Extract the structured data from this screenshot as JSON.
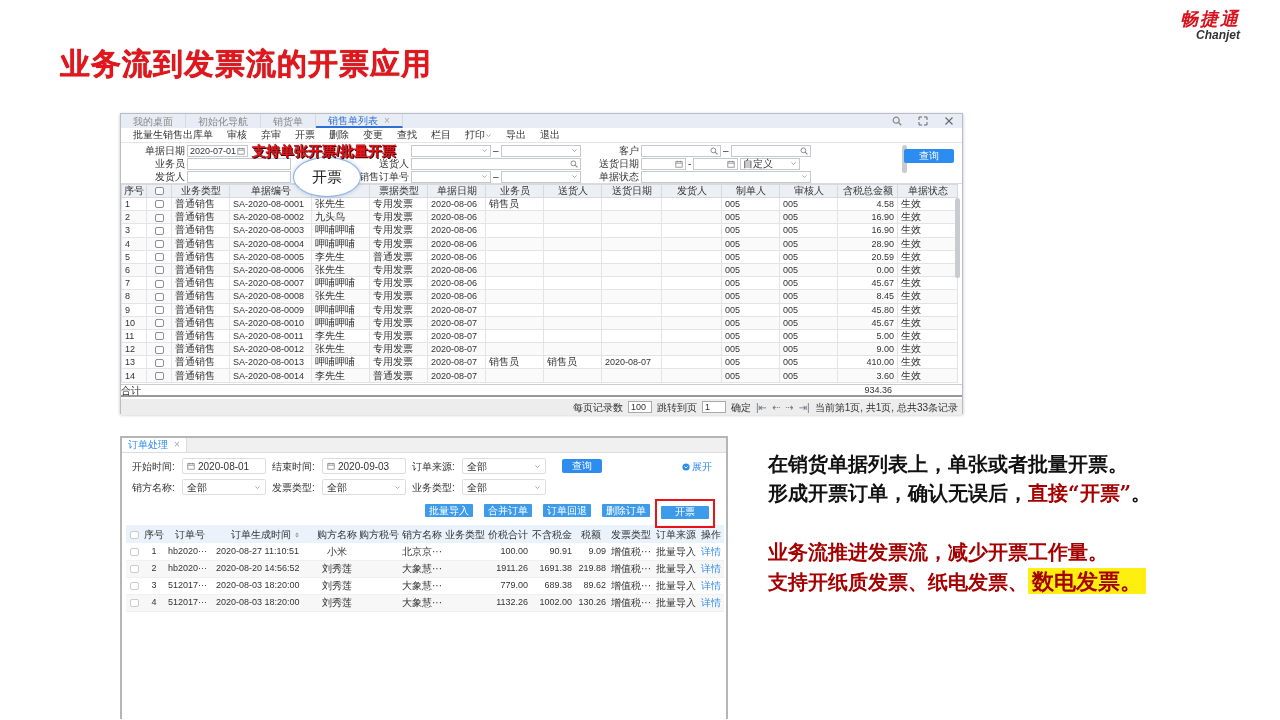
{
  "slide": {
    "title": "业务流到发票流的开票应用",
    "logo": {
      "name": "畅捷通",
      "latin": "Chanjet"
    }
  },
  "top_window": {
    "tabs": [
      {
        "label": "我的桌面",
        "selected": false,
        "closable": false
      },
      {
        "label": "初始化导航",
        "selected": false,
        "closable": false
      },
      {
        "label": "销货单",
        "selected": false,
        "closable": false
      },
      {
        "label": "销售单列表",
        "selected": true,
        "closable": true
      }
    ],
    "close_glyph": "×",
    "toolbar": [
      {
        "label": "批量生销售出库单",
        "dropdown": false
      },
      {
        "label": "审核",
        "dropdown": false
      },
      {
        "label": "弃审",
        "dropdown": false
      },
      {
        "label": "开票",
        "dropdown": false
      },
      {
        "label": "删除",
        "dropdown": false
      },
      {
        "label": "变更",
        "dropdown": false
      },
      {
        "label": "查找",
        "dropdown": false
      },
      {
        "label": "栏目",
        "dropdown": false
      },
      {
        "label": "打印",
        "dropdown": true
      },
      {
        "label": "导出",
        "dropdown": false
      },
      {
        "label": "退出",
        "dropdown": false
      }
    ],
    "filter_rows": [
      [
        {
          "label": "单据日期",
          "fields": [
            {
              "kind": "date",
              "value": "2020-07-01"
            }
          ]
        },
        {
          "fields": [
            {
              "kind": "select"
            },
            {
              "kind": "sep",
              "text": "–"
            },
            {
              "kind": "select"
            }
          ]
        },
        {
          "label": "客户",
          "fields": [
            {
              "kind": "search"
            },
            {
              "kind": "sep",
              "text": "–"
            },
            {
              "kind": "search"
            }
          ]
        }
      ],
      [
        {
          "label": "业务员",
          "fields": [
            {
              "kind": "text"
            }
          ]
        },
        {
          "label": "送货人",
          "fields": [
            {
              "kind": "search"
            }
          ]
        },
        {
          "label": "送货日期",
          "fields": [
            {
              "kind": "date"
            },
            {
              "kind": "sep",
              "text": "-"
            },
            {
              "kind": "date"
            },
            {
              "kind": "select",
              "value": "自定义"
            }
          ]
        }
      ],
      [
        {
          "label": "发货人",
          "fields": [
            {
              "kind": "text"
            }
          ]
        },
        {
          "label": "销售订单号",
          "fields": [
            {
              "kind": "select"
            },
            {
              "kind": "sep",
              "text": "–"
            },
            {
              "kind": "select"
            }
          ]
        },
        {
          "label": "单据状态",
          "fields": [
            {
              "kind": "select"
            }
          ]
        }
      ]
    ],
    "query_button": "查询",
    "callout": {
      "text": "支持单张开票/批量开票",
      "bubble": "开票"
    },
    "table": {
      "all_checked": false,
      "columns": [
        {
          "label": "序号",
          "kind": "text"
        },
        {
          "kind": "checkbox"
        },
        {
          "label": "业务类型",
          "kind": "text"
        },
        {
          "label": "单据编号",
          "kind": "text"
        },
        {
          "kind": "text"
        },
        {
          "label": "票据类型",
          "kind": "text"
        },
        {
          "label": "单据日期",
          "kind": "text"
        },
        {
          "label": "业务员",
          "kind": "text"
        },
        {
          "label": "送货人",
          "kind": "text"
        },
        {
          "label": "送货日期",
          "kind": "text"
        },
        {
          "label": "发货人",
          "kind": "text"
        },
        {
          "label": "制单人",
          "kind": "text"
        },
        {
          "label": "审核人",
          "kind": "text"
        },
        {
          "label": "含税总金额",
          "kind": "amount"
        },
        {
          "label": "单据状态",
          "kind": "text"
        }
      ],
      "rows": [
        {
          "checked": false,
          "cells": [
            "1",
            null,
            "普通销售",
            "SA-2020-08-0001",
            "张先生",
            "专用发票",
            "2020-08-06",
            "销售员",
            null,
            null,
            null,
            "005",
            "005",
            "4.58",
            "生效"
          ]
        },
        {
          "checked": false,
          "cells": [
            "2",
            null,
            "普通销售",
            "SA-2020-08-0002",
            "九头鸟",
            "专用发票",
            "2020-08-06",
            null,
            null,
            null,
            null,
            "005",
            "005",
            "16.90",
            "生效"
          ]
        },
        {
          "checked": false,
          "cells": [
            "3",
            null,
            "普通销售",
            "SA-2020-08-0003",
            "呷哺呷哺",
            "专用发票",
            "2020-08-06",
            null,
            null,
            null,
            null,
            "005",
            "005",
            "16.90",
            "生效"
          ]
        },
        {
          "checked": false,
          "cells": [
            "4",
            null,
            "普通销售",
            "SA-2020-08-0004",
            "呷哺呷哺",
            "专用发票",
            "2020-08-06",
            null,
            null,
            null,
            null,
            "005",
            "005",
            "28.90",
            "生效"
          ]
        },
        {
          "checked": false,
          "cells": [
            "5",
            null,
            "普通销售",
            "SA-2020-08-0005",
            "李先生",
            "普通发票",
            "2020-08-06",
            null,
            null,
            null,
            null,
            "005",
            "005",
            "20.59",
            "生效"
          ]
        },
        {
          "checked": false,
          "cells": [
            "6",
            null,
            "普通销售",
            "SA-2020-08-0006",
            "张先生",
            "专用发票",
            "2020-08-06",
            null,
            null,
            null,
            null,
            "005",
            "005",
            "0.00",
            "生效"
          ]
        },
        {
          "checked": false,
          "cells": [
            "7",
            null,
            "普通销售",
            "SA-2020-08-0007",
            "呷哺呷哺",
            "专用发票",
            "2020-08-06",
            null,
            null,
            null,
            null,
            "005",
            "005",
            "45.67",
            "生效"
          ]
        },
        {
          "checked": false,
          "cells": [
            "8",
            null,
            "普通销售",
            "SA-2020-08-0008",
            "张先生",
            "专用发票",
            "2020-08-06",
            null,
            null,
            null,
            null,
            "005",
            "005",
            "8.45",
            "生效"
          ]
        },
        {
          "checked": false,
          "cells": [
            "9",
            null,
            "普通销售",
            "SA-2020-08-0009",
            "呷哺呷哺",
            "专用发票",
            "2020-08-07",
            null,
            null,
            null,
            null,
            "005",
            "005",
            "45.80",
            "生效"
          ]
        },
        {
          "checked": false,
          "cells": [
            "10",
            null,
            "普通销售",
            "SA-2020-08-0010",
            "呷哺呷哺",
            "专用发票",
            "2020-08-07",
            null,
            null,
            null,
            null,
            "005",
            "005",
            "45.67",
            "生效"
          ]
        },
        {
          "checked": false,
          "cells": [
            "11",
            null,
            "普通销售",
            "SA-2020-08-0011",
            "李先生",
            "专用发票",
            "2020-08-07",
            null,
            null,
            null,
            null,
            "005",
            "005",
            "5.00",
            "生效"
          ]
        },
        {
          "checked": false,
          "cells": [
            "12",
            null,
            "普通销售",
            "SA-2020-08-0012",
            "张先生",
            "专用发票",
            "2020-08-07",
            null,
            null,
            null,
            null,
            "005",
            "005",
            "9.00",
            "生效"
          ]
        },
        {
          "checked": false,
          "cells": [
            "13",
            null,
            "普通销售",
            "SA-2020-08-0013",
            "呷哺呷哺",
            "专用发票",
            "2020-08-07",
            "销售员",
            "销售员",
            "2020-08-07",
            null,
            "005",
            "005",
            "410.00",
            "生效"
          ]
        },
        {
          "checked": false,
          "cells": [
            "14",
            null,
            "普通销售",
            "SA-2020-08-0014",
            "李先生",
            "普通发票",
            "2020-08-07",
            null,
            null,
            null,
            null,
            "005",
            "005",
            "3.60",
            "生效"
          ]
        }
      ]
    },
    "total": {
      "label": "合计",
      "amount": "934.36"
    },
    "pager": {
      "page_size_label": "每页记录数",
      "page_size": "100",
      "jump_label": "跳转到页",
      "page": "1",
      "confirm": "确定",
      "nav": [
        "|⇤",
        "⇠",
        "⇢",
        "⇥|"
      ],
      "summary": "当前第1页, 共1页, 总共33条记录"
    }
  },
  "bottom_window": {
    "tabs": [
      {
        "label": "订单处理",
        "selected": true,
        "closable": true
      }
    ],
    "close_glyph": "×",
    "filter_rows": [
      [
        {
          "label": "开始时间:",
          "kind": "date",
          "value": "2020-08-01"
        },
        {
          "label": "结束时间:",
          "kind": "date",
          "value": "2020-09-03"
        },
        {
          "label": "订单来源:",
          "kind": "select",
          "value": "全部"
        }
      ],
      [
        {
          "label": "销方名称:",
          "kind": "select",
          "value": "全部"
        },
        {
          "label": "发票类型:",
          "kind": "select",
          "value": "全部"
        },
        {
          "label": "业务类型:",
          "kind": "select",
          "value": "全部"
        }
      ]
    ],
    "query_button": "查询",
    "expand_link": "展开",
    "actions": [
      {
        "label": "批量导入",
        "highlighted": false
      },
      {
        "label": "合并订单",
        "highlighted": false
      },
      {
        "label": "订单回退",
        "highlighted": false
      },
      {
        "label": "删除订单",
        "highlighted": false
      },
      {
        "label": "开票",
        "highlighted": true
      }
    ],
    "table": {
      "all_checked": false,
      "columns": [
        {
          "kind": "checkbox"
        },
        {
          "label": "序号",
          "kind": "center"
        },
        {
          "label": "订单号",
          "kind": "text"
        },
        {
          "label": "订单生成时间",
          "kind": "text",
          "sortable": true
        },
        {
          "label": "购方名称",
          "kind": "center"
        },
        {
          "label": "购方税号",
          "kind": "center"
        },
        {
          "label": "销方名称",
          "kind": "center"
        },
        {
          "label": "业务类型",
          "kind": "center"
        },
        {
          "label": "价税合计",
          "kind": "amount"
        },
        {
          "label": "不含税金",
          "kind": "amount"
        },
        {
          "label": "税额",
          "kind": "amount"
        },
        {
          "label": "发票类型",
          "kind": "center"
        },
        {
          "label": "订单来源",
          "kind": "center"
        },
        {
          "label": "操作",
          "kind": "link"
        }
      ],
      "rows": [
        {
          "checked": false,
          "cells": [
            null,
            "1",
            "hb2020···",
            "2020-08-27 11:10:51",
            "小米",
            null,
            "北京京···",
            null,
            "100.00",
            "90.91",
            "9.09",
            "增值税···",
            "批量导入",
            "详情"
          ]
        },
        {
          "checked": false,
          "cells": [
            null,
            "2",
            "hb2020···",
            "2020-08-20 14:56:52",
            "刘秀莲",
            null,
            "大象慧···",
            null,
            "1911.26",
            "1691.38",
            "219.88",
            "增值税···",
            "批量导入",
            "详情"
          ]
        },
        {
          "checked": false,
          "cells": [
            null,
            "3",
            "512017···",
            "2020-08-03 18:20:00",
            "刘秀莲",
            null,
            "大象慧···",
            null,
            "779.00",
            "689.38",
            "89.62",
            "增值税···",
            "批量导入",
            "详情"
          ]
        },
        {
          "checked": false,
          "cells": [
            null,
            "4",
            "512017···",
            "2020-08-03 18:20:00",
            "刘秀莲",
            null,
            "大象慧···",
            null,
            "1132.26",
            "1002.00",
            "130.26",
            "增值税···",
            "批量导入",
            "详情"
          ]
        }
      ]
    }
  },
  "notes": [
    {
      "lines": [
        [
          {
            "text": "在销货单据列表上，单张或者批量开票。",
            "kind": "plain"
          }
        ],
        [
          {
            "text": "形成开票订单，确认无误后，",
            "kind": "plain"
          },
          {
            "text": "直接“开票”",
            "kind": "red"
          },
          {
            "text": "。",
            "kind": "plain"
          }
        ]
      ]
    },
    {
      "lines": [
        [
          {
            "text": "业务流推进发票流，减少开票工作量。",
            "kind": "red"
          }
        ],
        [
          {
            "text": "支持开纸质发票、纸电发票、",
            "kind": "red"
          },
          {
            "text": "数电发票。",
            "kind": "highlight"
          }
        ]
      ]
    }
  ]
}
